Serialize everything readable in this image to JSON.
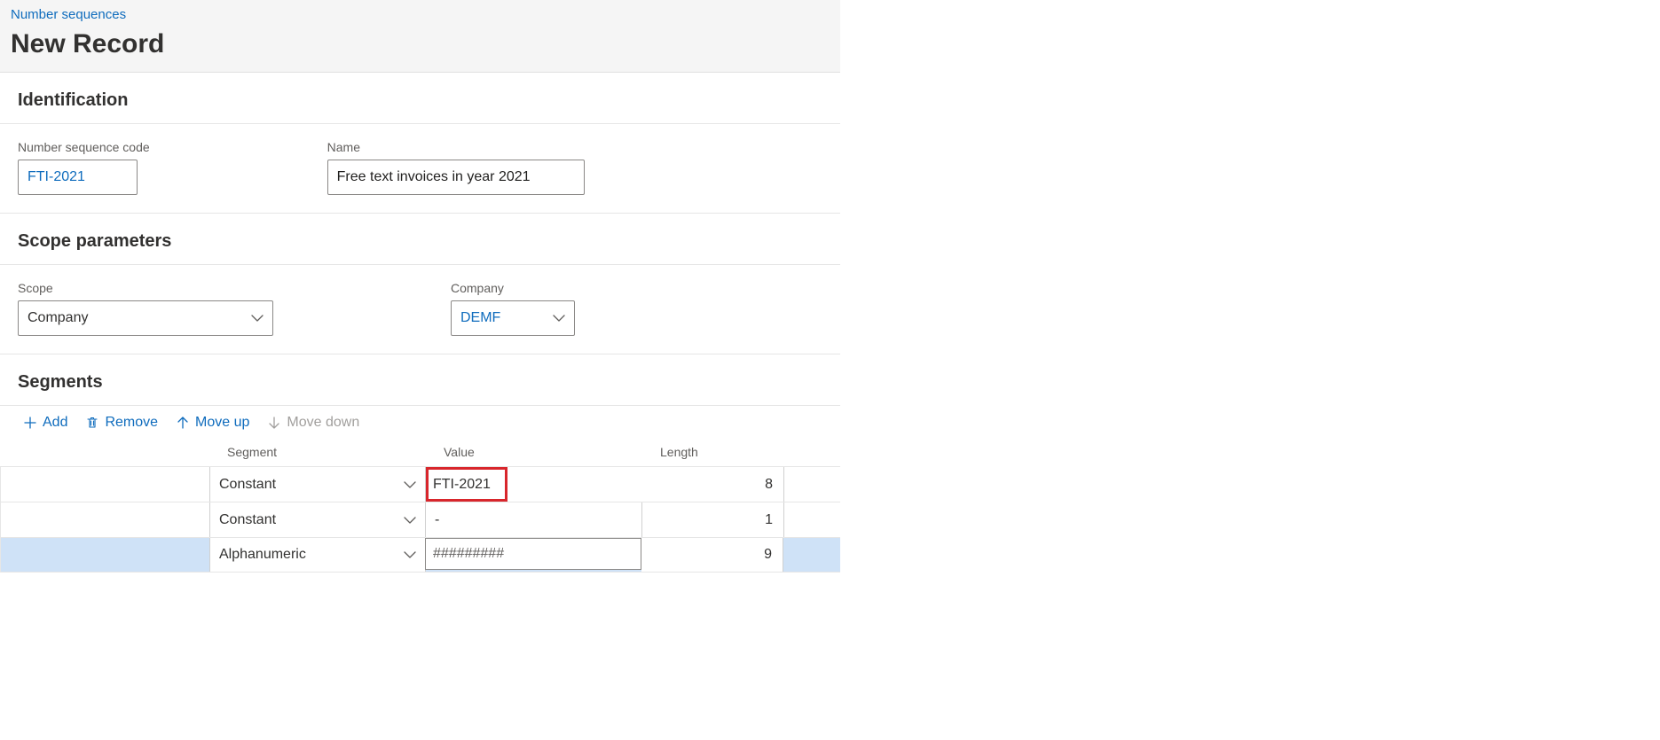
{
  "header": {
    "breadcrumb": "Number sequences",
    "title": "New Record"
  },
  "identification": {
    "section_title": "Identification",
    "code_label": "Number sequence code",
    "code_value": "FTI-2021",
    "name_label": "Name",
    "name_value": "Free text invoices in year 2021"
  },
  "scope": {
    "section_title": "Scope parameters",
    "scope_label": "Scope",
    "scope_value": "Company",
    "company_label": "Company",
    "company_value": "DEMF"
  },
  "segments": {
    "section_title": "Segments",
    "toolbar": {
      "add": "Add",
      "remove": "Remove",
      "moveup": "Move up",
      "movedown": "Move down"
    },
    "columns": {
      "segment": "Segment",
      "value": "Value",
      "length": "Length"
    },
    "rows": [
      {
        "segment": "Constant",
        "value": "FTI-2021",
        "length": "8"
      },
      {
        "segment": "Constant",
        "value": "-",
        "length": "1"
      },
      {
        "segment": "Alphanumeric",
        "value": "#########",
        "length": "9"
      }
    ]
  }
}
